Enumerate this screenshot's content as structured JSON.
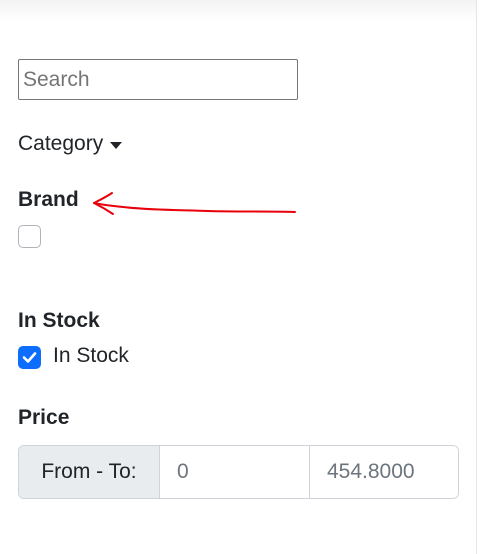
{
  "search": {
    "placeholder": "Search",
    "value": ""
  },
  "filters": {
    "category": {
      "label": "Category",
      "icon": "caret-down-icon"
    },
    "brand": {
      "heading": "Brand",
      "checkbox_checked": false
    },
    "in_stock": {
      "heading": "In Stock",
      "option_label": "In Stock",
      "checked": true
    },
    "price": {
      "heading": "Price",
      "range_label": "From - To:",
      "from_value": "0",
      "to_value": "454.8000"
    }
  },
  "annotation": {
    "icon": "red-arrow-annotation",
    "color": "#e8000b"
  },
  "colors": {
    "accent": "#0d6efd",
    "text": "#212529",
    "muted": "#6c757d"
  }
}
